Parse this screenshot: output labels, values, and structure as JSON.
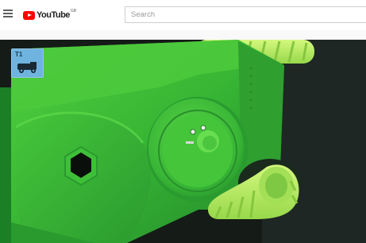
{
  "header": {
    "logo_text": "YouTube",
    "logo_region": "GB",
    "search_placeholder": "Search"
  },
  "video": {
    "channel_badge": "T1"
  },
  "colors": {
    "brand_red": "#ff0000",
    "robot_green": "#3cb93c",
    "wheel_lime": "#b9ef63"
  },
  "icons": [
    "menu-icon",
    "youtube-logo-icon",
    "channel-logo-icon"
  ]
}
